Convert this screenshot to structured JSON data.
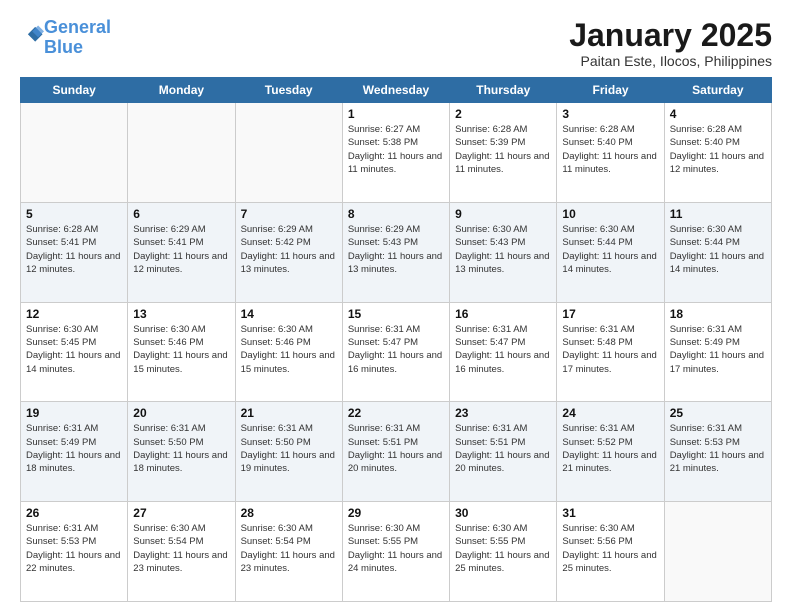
{
  "brand": {
    "line1": "General",
    "line2": "Blue"
  },
  "title": "January 2025",
  "subtitle": "Paitan Este, Ilocos, Philippines",
  "days": [
    "Sunday",
    "Monday",
    "Tuesday",
    "Wednesday",
    "Thursday",
    "Friday",
    "Saturday"
  ],
  "weeks": [
    [
      {
        "date": "",
        "info": ""
      },
      {
        "date": "",
        "info": ""
      },
      {
        "date": "",
        "info": ""
      },
      {
        "date": "1",
        "info": "Sunrise: 6:27 AM\nSunset: 5:38 PM\nDaylight: 11 hours and 11 minutes."
      },
      {
        "date": "2",
        "info": "Sunrise: 6:28 AM\nSunset: 5:39 PM\nDaylight: 11 hours and 11 minutes."
      },
      {
        "date": "3",
        "info": "Sunrise: 6:28 AM\nSunset: 5:40 PM\nDaylight: 11 hours and 11 minutes."
      },
      {
        "date": "4",
        "info": "Sunrise: 6:28 AM\nSunset: 5:40 PM\nDaylight: 11 hours and 12 minutes."
      }
    ],
    [
      {
        "date": "5",
        "info": "Sunrise: 6:28 AM\nSunset: 5:41 PM\nDaylight: 11 hours and 12 minutes."
      },
      {
        "date": "6",
        "info": "Sunrise: 6:29 AM\nSunset: 5:41 PM\nDaylight: 11 hours and 12 minutes."
      },
      {
        "date": "7",
        "info": "Sunrise: 6:29 AM\nSunset: 5:42 PM\nDaylight: 11 hours and 13 minutes."
      },
      {
        "date": "8",
        "info": "Sunrise: 6:29 AM\nSunset: 5:43 PM\nDaylight: 11 hours and 13 minutes."
      },
      {
        "date": "9",
        "info": "Sunrise: 6:30 AM\nSunset: 5:43 PM\nDaylight: 11 hours and 13 minutes."
      },
      {
        "date": "10",
        "info": "Sunrise: 6:30 AM\nSunset: 5:44 PM\nDaylight: 11 hours and 14 minutes."
      },
      {
        "date": "11",
        "info": "Sunrise: 6:30 AM\nSunset: 5:44 PM\nDaylight: 11 hours and 14 minutes."
      }
    ],
    [
      {
        "date": "12",
        "info": "Sunrise: 6:30 AM\nSunset: 5:45 PM\nDaylight: 11 hours and 14 minutes."
      },
      {
        "date": "13",
        "info": "Sunrise: 6:30 AM\nSunset: 5:46 PM\nDaylight: 11 hours and 15 minutes."
      },
      {
        "date": "14",
        "info": "Sunrise: 6:30 AM\nSunset: 5:46 PM\nDaylight: 11 hours and 15 minutes."
      },
      {
        "date": "15",
        "info": "Sunrise: 6:31 AM\nSunset: 5:47 PM\nDaylight: 11 hours and 16 minutes."
      },
      {
        "date": "16",
        "info": "Sunrise: 6:31 AM\nSunset: 5:47 PM\nDaylight: 11 hours and 16 minutes."
      },
      {
        "date": "17",
        "info": "Sunrise: 6:31 AM\nSunset: 5:48 PM\nDaylight: 11 hours and 17 minutes."
      },
      {
        "date": "18",
        "info": "Sunrise: 6:31 AM\nSunset: 5:49 PM\nDaylight: 11 hours and 17 minutes."
      }
    ],
    [
      {
        "date": "19",
        "info": "Sunrise: 6:31 AM\nSunset: 5:49 PM\nDaylight: 11 hours and 18 minutes."
      },
      {
        "date": "20",
        "info": "Sunrise: 6:31 AM\nSunset: 5:50 PM\nDaylight: 11 hours and 18 minutes."
      },
      {
        "date": "21",
        "info": "Sunrise: 6:31 AM\nSunset: 5:50 PM\nDaylight: 11 hours and 19 minutes."
      },
      {
        "date": "22",
        "info": "Sunrise: 6:31 AM\nSunset: 5:51 PM\nDaylight: 11 hours and 20 minutes."
      },
      {
        "date": "23",
        "info": "Sunrise: 6:31 AM\nSunset: 5:51 PM\nDaylight: 11 hours and 20 minutes."
      },
      {
        "date": "24",
        "info": "Sunrise: 6:31 AM\nSunset: 5:52 PM\nDaylight: 11 hours and 21 minutes."
      },
      {
        "date": "25",
        "info": "Sunrise: 6:31 AM\nSunset: 5:53 PM\nDaylight: 11 hours and 21 minutes."
      }
    ],
    [
      {
        "date": "26",
        "info": "Sunrise: 6:31 AM\nSunset: 5:53 PM\nDaylight: 11 hours and 22 minutes."
      },
      {
        "date": "27",
        "info": "Sunrise: 6:30 AM\nSunset: 5:54 PM\nDaylight: 11 hours and 23 minutes."
      },
      {
        "date": "28",
        "info": "Sunrise: 6:30 AM\nSunset: 5:54 PM\nDaylight: 11 hours and 23 minutes."
      },
      {
        "date": "29",
        "info": "Sunrise: 6:30 AM\nSunset: 5:55 PM\nDaylight: 11 hours and 24 minutes."
      },
      {
        "date": "30",
        "info": "Sunrise: 6:30 AM\nSunset: 5:55 PM\nDaylight: 11 hours and 25 minutes."
      },
      {
        "date": "31",
        "info": "Sunrise: 6:30 AM\nSunset: 5:56 PM\nDaylight: 11 hours and 25 minutes."
      },
      {
        "date": "",
        "info": ""
      }
    ]
  ]
}
